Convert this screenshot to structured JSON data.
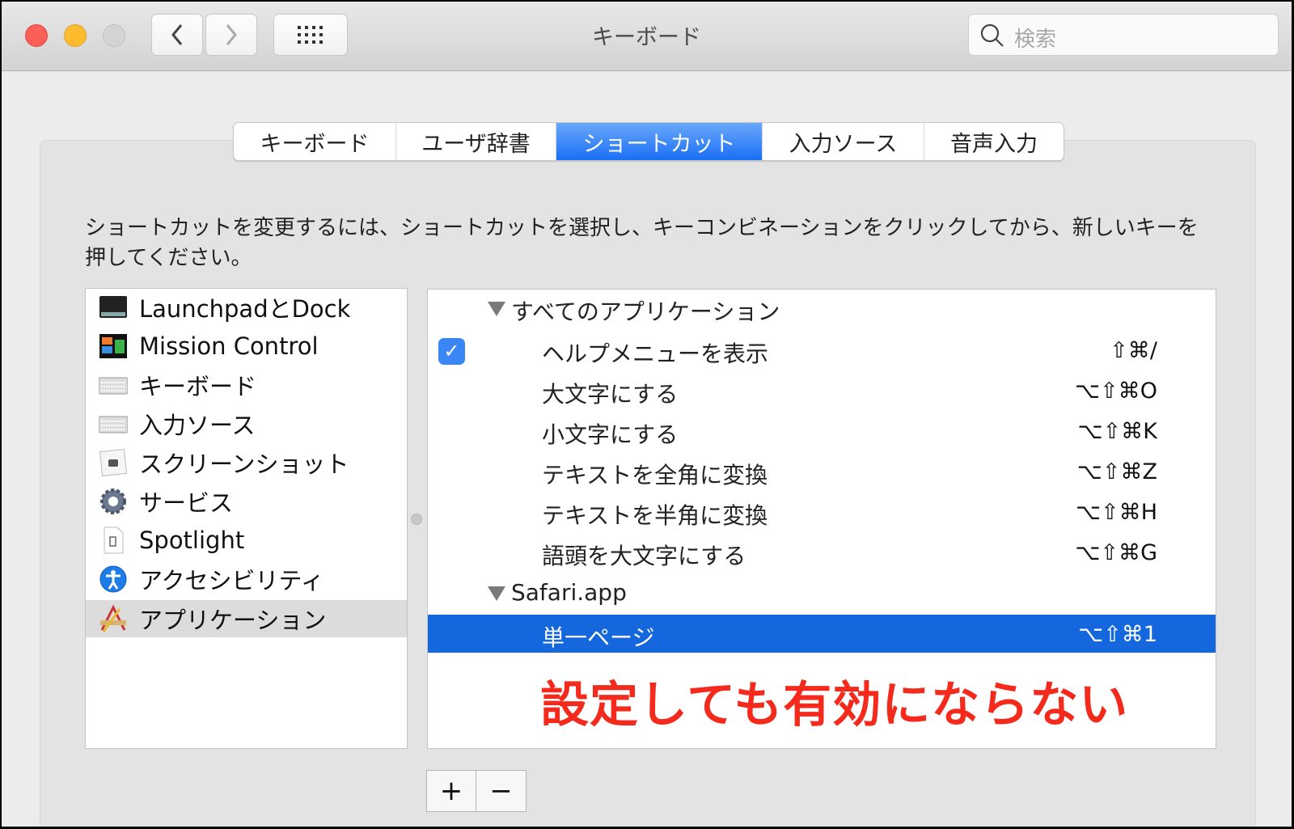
{
  "window": {
    "title": "キーボード",
    "search_placeholder": "検索"
  },
  "tabs": [
    {
      "label": "キーボード"
    },
    {
      "label": "ユーザ辞書"
    },
    {
      "label": "ショートカット",
      "selected": true
    },
    {
      "label": "入力ソース"
    },
    {
      "label": "音声入力"
    }
  ],
  "description": "ショートカットを変更するには、ショートカットを選択し、キーコンビネーションをクリックしてから、新しいキーを押してください。",
  "categories": [
    {
      "label": "LaunchpadとDock",
      "icon": "launchpad-icon"
    },
    {
      "label": "Mission Control",
      "icon": "mission-control-icon"
    },
    {
      "label": "キーボード",
      "icon": "keyboard-icon"
    },
    {
      "label": "入力ソース",
      "icon": "keyboard-icon"
    },
    {
      "label": "スクリーンショット",
      "icon": "screenshot-icon"
    },
    {
      "label": "サービス",
      "icon": "gear-icon"
    },
    {
      "label": "Spotlight",
      "icon": "spotlight-icon"
    },
    {
      "label": "アクセシビリティ",
      "icon": "accessibility-icon"
    },
    {
      "label": "アプリケーション",
      "icon": "app-icon",
      "selected": true
    }
  ],
  "groups": [
    {
      "header": "すべてのアプリケーション",
      "items": [
        {
          "name": "ヘルプメニューを表示",
          "shortcut": "⇧⌘/",
          "checked": true
        },
        {
          "name": "大文字にする",
          "shortcut": "⌥⇧⌘O"
        },
        {
          "name": "小文字にする",
          "shortcut": "⌥⇧⌘K"
        },
        {
          "name": "テキストを全角に変換",
          "shortcut": "⌥⇧⌘Z"
        },
        {
          "name": "テキストを半角に変換",
          "shortcut": "⌥⇧⌘H"
        },
        {
          "name": "語頭を大文字にする",
          "shortcut": "⌥⇧⌘G"
        }
      ]
    },
    {
      "header": "Safari.app",
      "items": [
        {
          "name": "単一ページ",
          "shortcut": "⌥⇧⌘1",
          "selected": true
        }
      ]
    }
  ],
  "annotation": "設定しても有効にならない",
  "buttons": {
    "add": "+",
    "remove": "−"
  },
  "colors": {
    "accent": "#1467dd",
    "annotation": "#f42a1c"
  }
}
